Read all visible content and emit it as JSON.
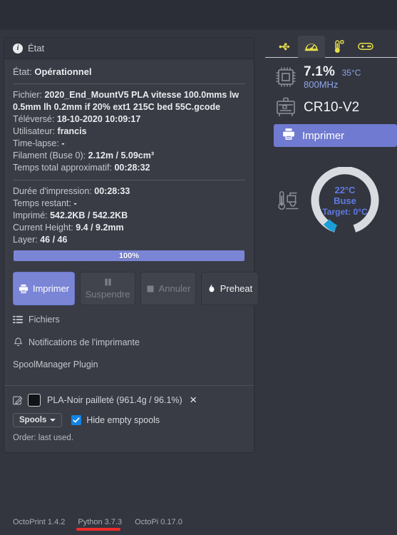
{
  "status_panel": {
    "header_title": "État",
    "header_icon": "info-circle-icon",
    "state_label": "État:",
    "state_value": "Opérationnel",
    "file_label": "Fichier:",
    "file_value": "2020_End_MountV5 PLA vitesse 100.0mms lw 0.5mm lh 0.2mm if 20% ext1 215C bed 55C.gcode",
    "uploaded_label": "Téléversé:",
    "uploaded_value": "18-10-2020 10:09:17",
    "user_label": "Utilisateur:",
    "user_value": "francis",
    "timelapse_label": "Time-lapse:",
    "timelapse_value": "-",
    "filament_label": "Filament (Buse 0):",
    "filament_value": "2.12m / 5.09cm³",
    "total_time_label": "Temps total approximatif:",
    "total_time_value": "00:28:32",
    "print_time_label": "Durée d'impression:",
    "print_time_value": "00:28:33",
    "time_left_label": "Temps restant:",
    "time_left_value": "-",
    "printed_label": "Imprimé:",
    "printed_value": "542.2KB / 542.2KB",
    "height_label": "Current Height:",
    "height_value": "9.4 / 9.2mm",
    "layer_label": "Layer:",
    "layer_value": "46 / 46",
    "progress_percent": "100%",
    "progress_value": 100,
    "progress_color": "#7b85d6"
  },
  "actions": {
    "print_label": "Imprimer",
    "pause_label": "Suspendre",
    "cancel_label": "Annuler",
    "preheat_label": "Preheat"
  },
  "links": {
    "files_label": "Fichiers",
    "notifications_label": "Notifications de l'imprimante",
    "spoolmanager_label": "SpoolManager Plugin"
  },
  "spool": {
    "name": "PLA-Noir pailleté (961.4g / 96.1%)",
    "color": "#111317",
    "spools_button": "Spools",
    "hide_empty_label": "Hide empty spools",
    "hide_empty_checked": true,
    "order_text": "Order: last used."
  },
  "right_sidebar": {
    "tabs": [
      {
        "name": "usb-icon",
        "label": "USB",
        "active": false
      },
      {
        "name": "dashboard-gauge-icon",
        "label": "Tableau de bord",
        "active": true
      },
      {
        "name": "thermometer-icon",
        "label": "Températures",
        "active": false
      },
      {
        "name": "gamepad-icon",
        "label": "Contrôle",
        "active": false
      }
    ],
    "cpu": {
      "icon": "cpu-chip-icon",
      "usage": "7.1%",
      "temperature": "35°C",
      "frequency": "800MHz",
      "accent": "#8fa4e8"
    },
    "printer": {
      "icon": "printer-profile-icon",
      "name": "CR10-V2"
    },
    "print_button": {
      "icon": "printer-icon",
      "label": "Imprimer",
      "color": "#6f7ad0"
    },
    "temperature_gauge": {
      "icon": "extruder-thermometer-icon",
      "value": "22°C",
      "name": "Buse",
      "target": "Target: 0°C",
      "track_color": "#d8dce0",
      "fill_color": "#1a9fd9",
      "text_color": "#5f7ae4",
      "percent": 12
    }
  },
  "footer": {
    "items": [
      {
        "label": "OctoPrint 1.4.2",
        "underlined": false
      },
      {
        "label": "Python 3.7.3",
        "underlined": true
      },
      {
        "label": "OctoPi 0.17.0",
        "underlined": false
      }
    ],
    "underline_color": "#ef2b2b"
  }
}
